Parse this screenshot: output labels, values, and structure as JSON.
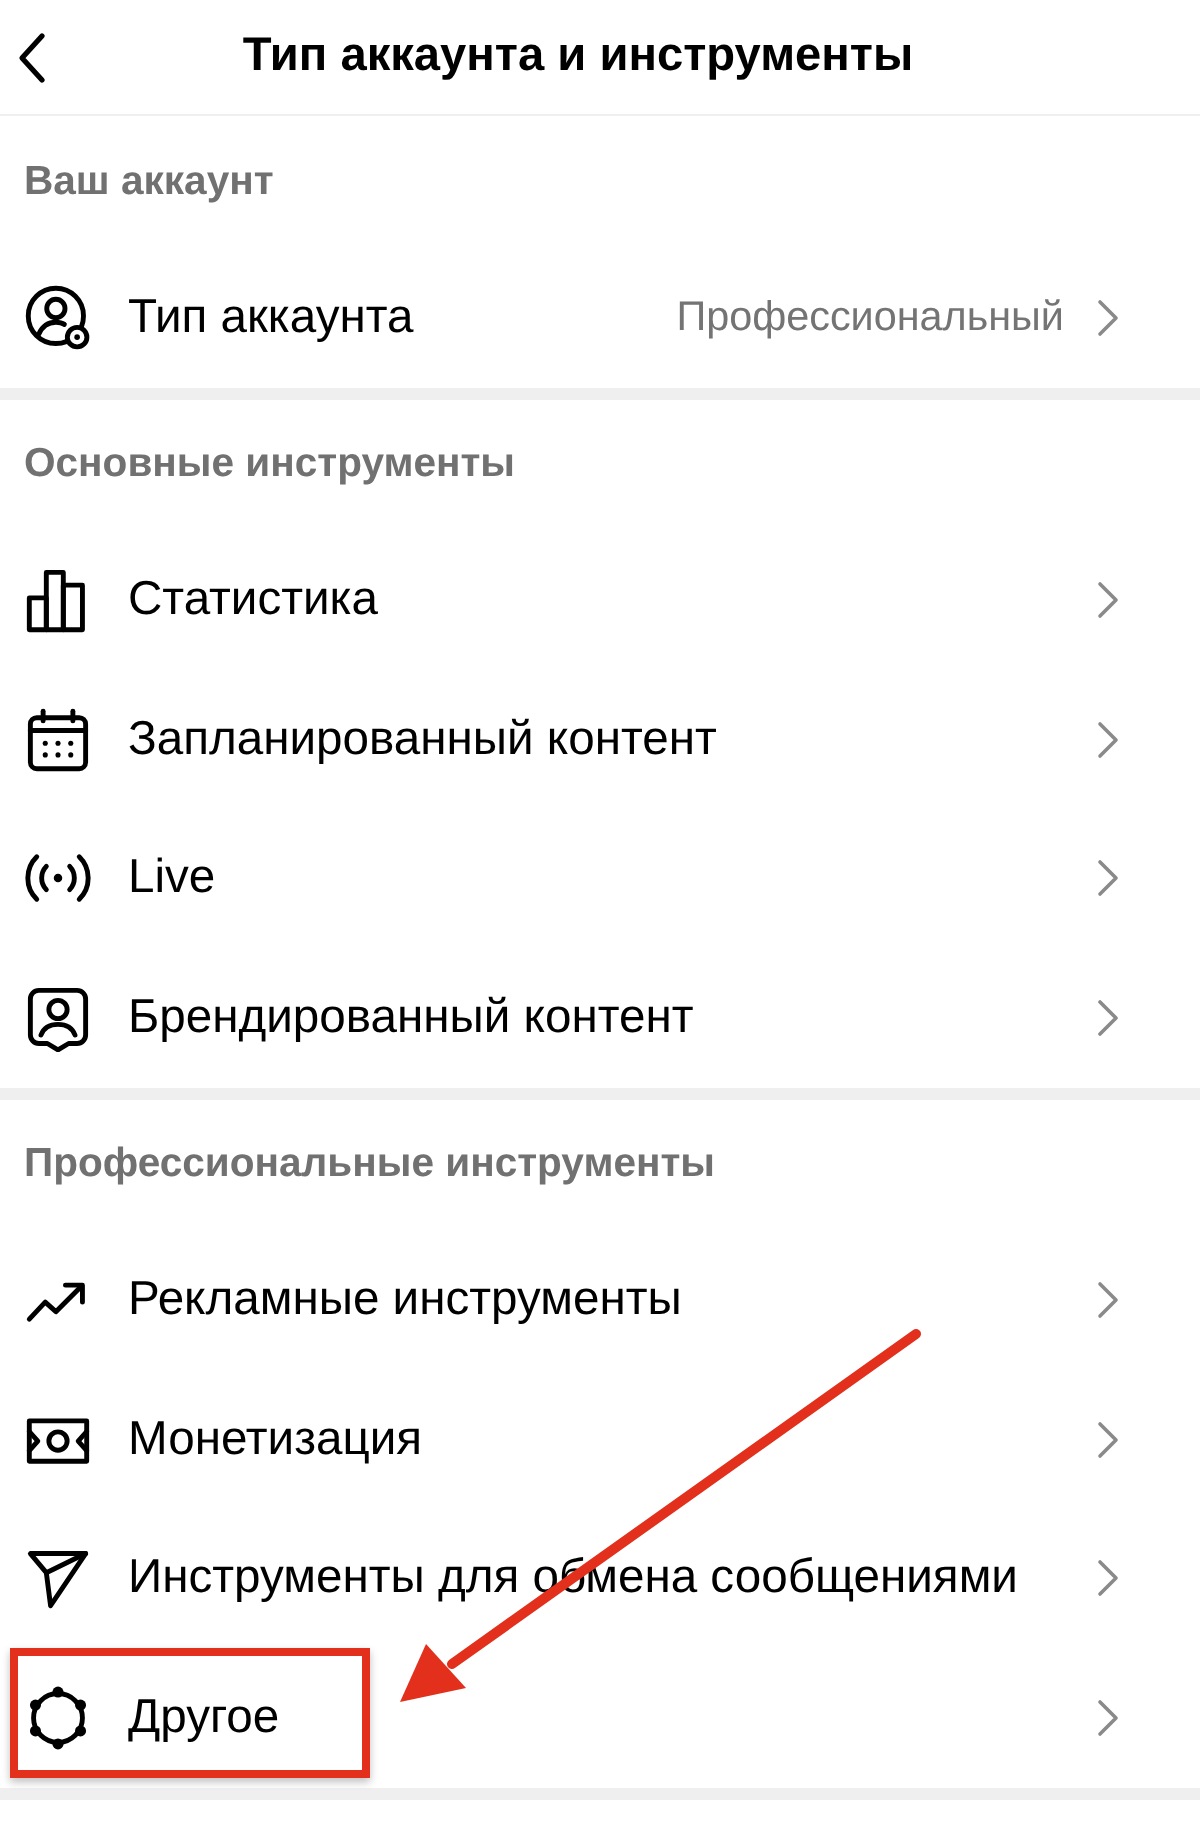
{
  "header": {
    "title": "Тип аккаунта и инструменты"
  },
  "sections": [
    {
      "title": "Ваш аккаунт",
      "items": [
        {
          "kind": "account",
          "label": "Тип аккаунта",
          "value": "Профессиональный",
          "highlighted": false
        }
      ]
    },
    {
      "title": "Основные инструменты",
      "items": [
        {
          "kind": "stats",
          "label": "Статистика",
          "highlighted": false
        },
        {
          "kind": "calendar",
          "label": "Запланированный контент",
          "highlighted": false
        },
        {
          "kind": "live",
          "label": "Live",
          "highlighted": false
        },
        {
          "kind": "branded",
          "label": "Брендированный контент",
          "highlighted": false
        }
      ]
    },
    {
      "title": "Профессиональные инструменты",
      "items": [
        {
          "kind": "ads",
          "label": "Рекламные инструменты",
          "highlighted": false
        },
        {
          "kind": "money",
          "label": "Монетизация",
          "highlighted": false
        },
        {
          "kind": "messaging",
          "label": "Инструменты для обмена сообщениями",
          "highlighted": false
        },
        {
          "kind": "other",
          "label": "Другое",
          "highlighted": true
        }
      ]
    }
  ]
}
